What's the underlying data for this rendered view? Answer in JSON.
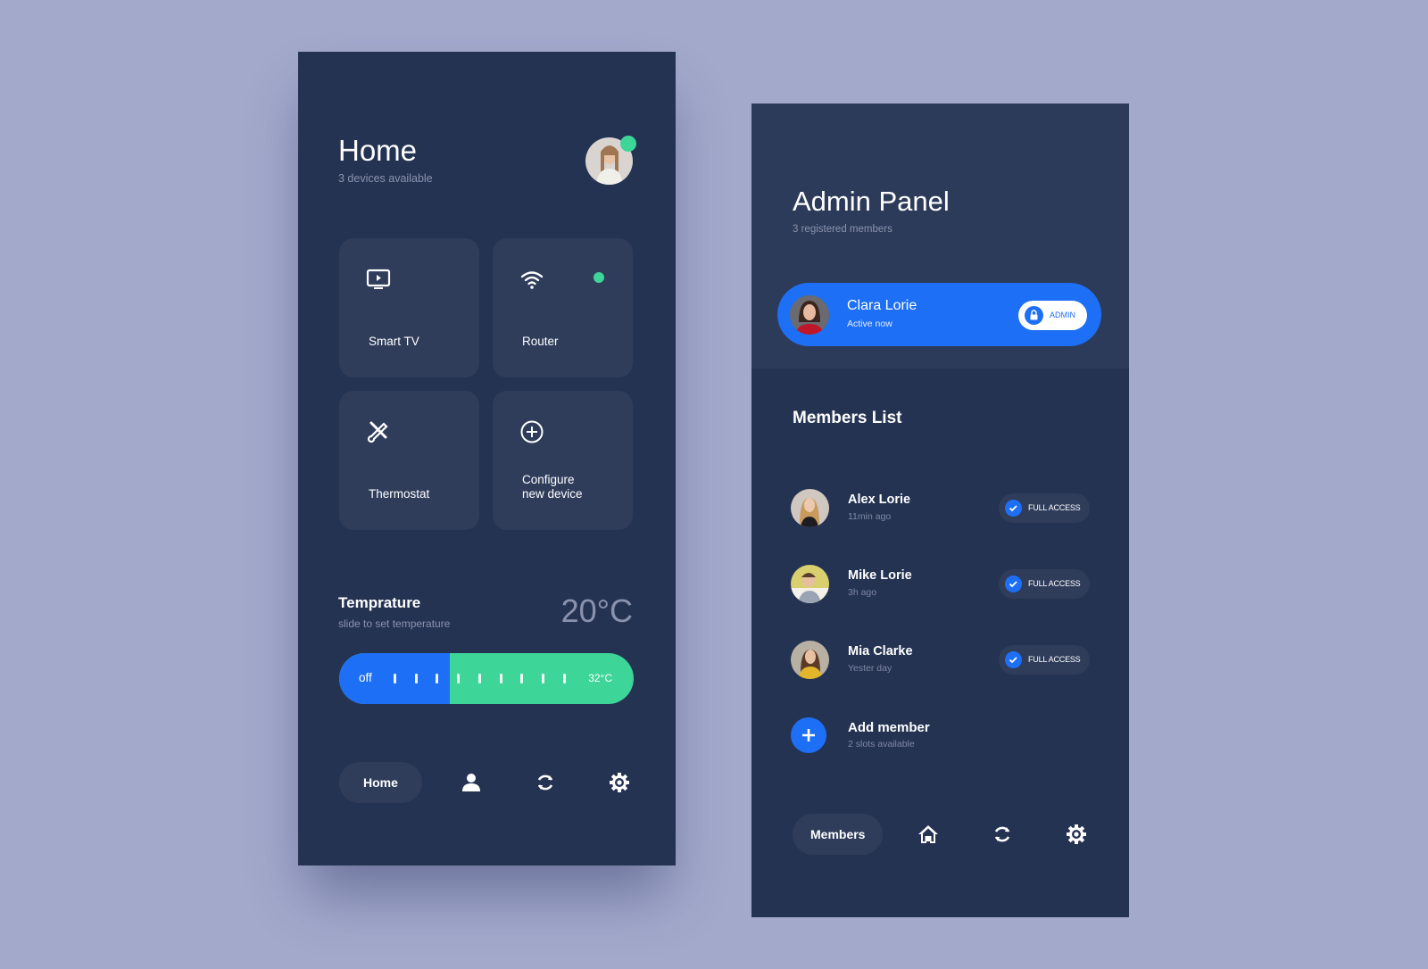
{
  "home": {
    "title": "Home",
    "subtitle": "3 devices available",
    "devices": [
      {
        "label": "Smart TV",
        "icon": "tv-icon",
        "online": false
      },
      {
        "label": "Router",
        "icon": "wifi-icon",
        "online": true
      },
      {
        "label": "Thermostat",
        "icon": "tools-icon",
        "online": false
      },
      {
        "label": "Configure\nnew device",
        "label_line1": "Configure",
        "label_line2": "new device",
        "icon": "plus-circle-icon",
        "online": false
      }
    ],
    "temperature": {
      "title": "Temprature",
      "subtitle": "slide to set temperature",
      "value": "20°C",
      "slider_min_label": "off",
      "slider_max_label": "32°C",
      "slider_fraction": 0.375
    },
    "nav": {
      "active_label": "Home",
      "icons": [
        "user-icon",
        "refresh-icon",
        "gear-icon"
      ]
    }
  },
  "admin": {
    "title": "Admin Panel",
    "subtitle": "3 registered members",
    "current_user": {
      "name": "Clara Lorie",
      "status": "Active now",
      "badge": "ADMIN"
    },
    "members_title": "Members List",
    "members": [
      {
        "name": "Alex Lorie",
        "time": "11min ago",
        "access": "FULL ACCESS"
      },
      {
        "name": "Mike Lorie",
        "time": "3h ago",
        "access": "FULL ACCESS"
      },
      {
        "name": "Mia Clarke",
        "time": "Yester day",
        "access": "FULL ACCESS"
      }
    ],
    "add_member": {
      "label": "Add member",
      "sub": "2 slots available"
    },
    "nav": {
      "active_label": "Members",
      "icons": [
        "home-icon",
        "refresh-icon",
        "gear-icon"
      ]
    }
  },
  "colors": {
    "accent_blue": "#1d6ff5",
    "accent_green": "#3dd598",
    "panel": "#253353",
    "tile": "#2f3d5b",
    "background": "#a3a9cb"
  }
}
